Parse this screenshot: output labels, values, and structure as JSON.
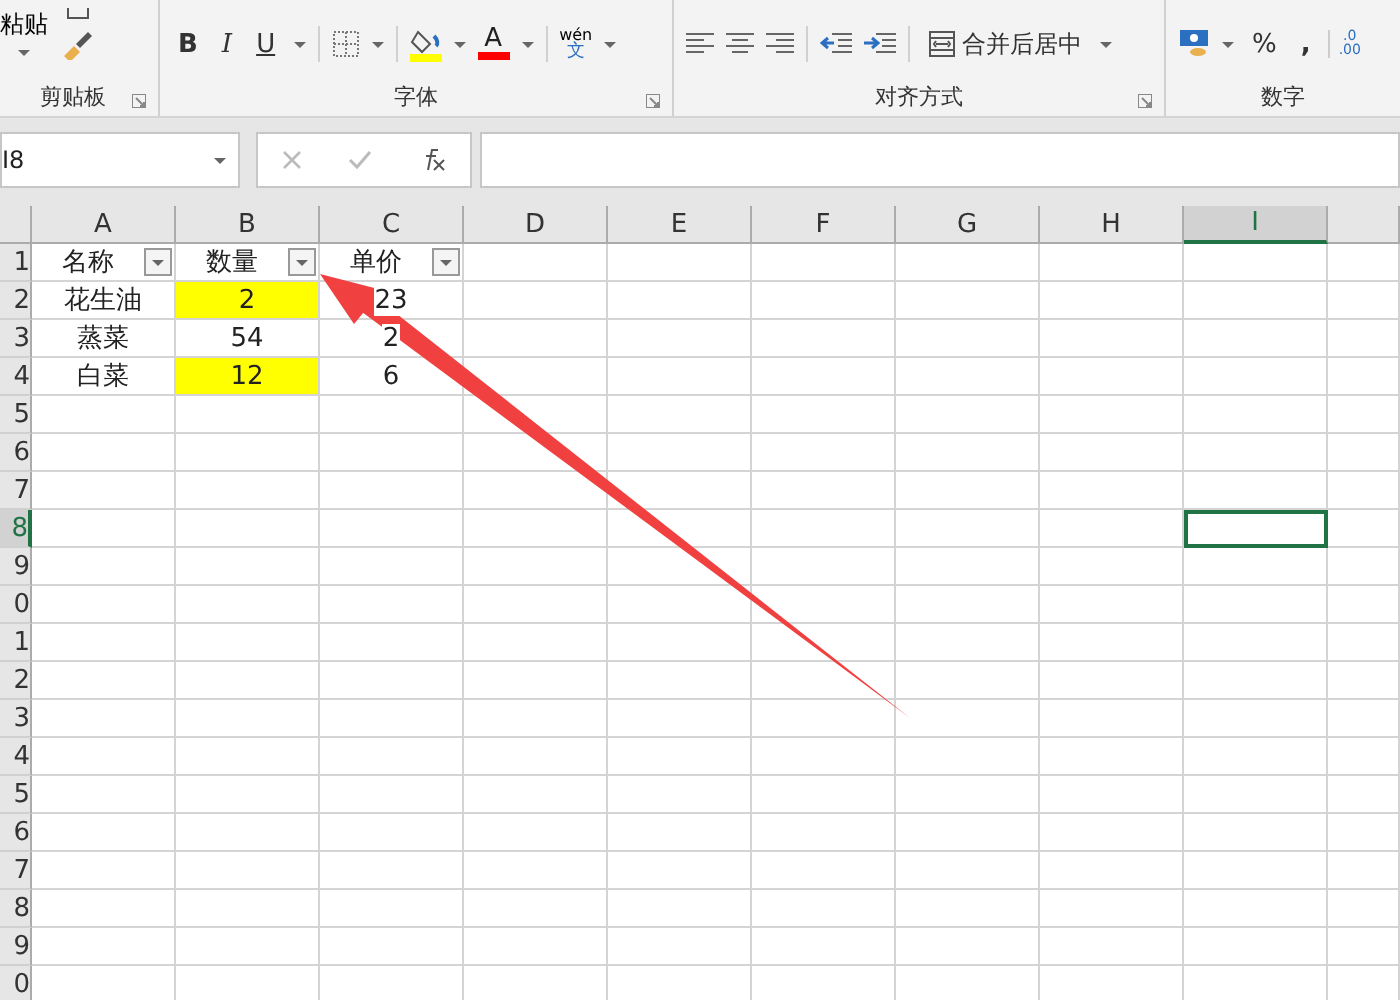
{
  "ribbon": {
    "groups": [
      {
        "kind": "clipboard",
        "label": "剪贴板",
        "paste": "粘贴"
      },
      {
        "kind": "font",
        "label": "字体",
        "bold": "B",
        "italic": "I",
        "underline": "U",
        "font_color": "A",
        "phonetic_top": "wén",
        "phonetic_bottom": "文"
      },
      {
        "kind": "alignment",
        "label": "对齐方式",
        "merge": "合并后居中"
      },
      {
        "kind": "number",
        "label": "数字",
        "percent": "%",
        "comma": ",",
        "decimal_top": ".0",
        "decimal_bottom": ".00"
      }
    ]
  },
  "formula_bar": {
    "name_box": "I8"
  },
  "sheet": {
    "columns": [
      {
        "label": "A",
        "selected": false
      },
      {
        "label": "B",
        "selected": false
      },
      {
        "label": "C",
        "selected": false
      },
      {
        "label": "D",
        "selected": false
      },
      {
        "label": "E",
        "selected": false
      },
      {
        "label": "F",
        "selected": false
      },
      {
        "label": "G",
        "selected": false
      },
      {
        "label": "H",
        "selected": false
      },
      {
        "label": "I",
        "selected": true
      }
    ],
    "rows": [
      {
        "header": "1",
        "selected": false,
        "cells": [
          {
            "text": "名称",
            "filter": true,
            "highlighted": false
          },
          {
            "text": "数量",
            "filter": true,
            "highlighted": false
          },
          {
            "text": "单价",
            "filter": true,
            "highlighted": false
          }
        ]
      },
      {
        "header": "2",
        "selected": false,
        "cells": [
          {
            "text": "花生油",
            "filter": false,
            "highlighted": false
          },
          {
            "text": "2",
            "filter": false,
            "highlighted": true
          },
          {
            "text": "23",
            "filter": false,
            "highlighted": false
          }
        ]
      },
      {
        "header": "3",
        "selected": false,
        "cells": [
          {
            "text": "蒸菜",
            "filter": false,
            "highlighted": false
          },
          {
            "text": "54",
            "filter": false,
            "highlighted": false
          },
          {
            "text": "2",
            "filter": false,
            "highlighted": false
          }
        ]
      },
      {
        "header": "4",
        "selected": false,
        "cells": [
          {
            "text": "白菜",
            "filter": false,
            "highlighted": false
          },
          {
            "text": "12",
            "filter": false,
            "highlighted": true
          },
          {
            "text": "6",
            "filter": false,
            "highlighted": false
          }
        ]
      },
      {
        "header": "5",
        "selected": false,
        "cells": []
      },
      {
        "header": "6",
        "selected": false,
        "cells": []
      },
      {
        "header": "7",
        "selected": false,
        "cells": []
      },
      {
        "header": "8",
        "selected": true,
        "cells": []
      },
      {
        "header": "9",
        "selected": false,
        "cells": []
      },
      {
        "header": "0",
        "selected": false,
        "cells": []
      },
      {
        "header": "1",
        "selected": false,
        "cells": []
      },
      {
        "header": "2",
        "selected": false,
        "cells": []
      },
      {
        "header": "3",
        "selected": false,
        "cells": []
      },
      {
        "header": "4",
        "selected": false,
        "cells": []
      },
      {
        "header": "5",
        "selected": false,
        "cells": []
      },
      {
        "header": "6",
        "selected": false,
        "cells": []
      },
      {
        "header": "7",
        "selected": false,
        "cells": []
      },
      {
        "header": "8",
        "selected": false,
        "cells": []
      },
      {
        "header": "9",
        "selected": false,
        "cells": []
      },
      {
        "header": "0",
        "selected": false,
        "cells": []
      }
    ]
  }
}
